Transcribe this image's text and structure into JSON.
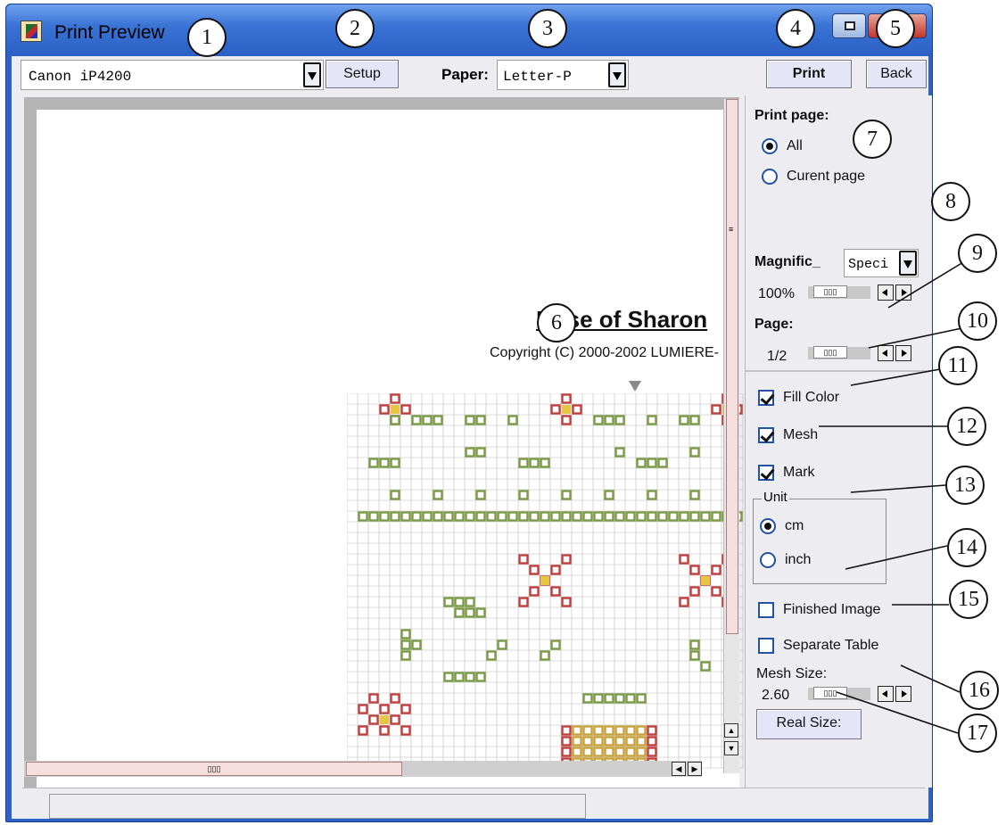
{
  "window": {
    "title": "Print Preview"
  },
  "toolbar": {
    "printer_value": "Canon iP4200",
    "setup_label": "Setup",
    "paper_label": "Paper:",
    "paper_value": "Letter-P",
    "print_label": "Print",
    "back_label": "Back"
  },
  "document": {
    "title": "Rose of Sharon",
    "copyright": "Copyright (C) 2000-2002 LUMIERE-"
  },
  "panel": {
    "print_page_label": "Print page:",
    "radio_all": "All",
    "radio_current": "Curent page",
    "magnification_label": "Magnific_",
    "magnification_value": "Speci",
    "zoom_value": "100%",
    "page_label": "Page:",
    "page_value": "1/2",
    "fill_color": "Fill Color",
    "mesh": "Mesh",
    "mark": "Mark",
    "unit_label": "Unit",
    "unit_cm": "cm",
    "unit_inch": "inch",
    "finished_image": "Finished Image",
    "separate_table": "Separate Table",
    "mesh_size_label": "Mesh Size:",
    "mesh_size_value": "2.60",
    "real_size": "Real Size:"
  },
  "state": {
    "print_page": "All",
    "fill_color": true,
    "mesh": true,
    "mark": true,
    "unit": "cm",
    "finished_image": false,
    "separate_table": false
  },
  "colors": {
    "title_bar": "#2f62c8",
    "button_face": "#e4e5f6",
    "stitch_red": "#c0403f",
    "stitch_green": "#7a9a45",
    "stitch_yellow": "#e6c642"
  },
  "callouts": [
    "1",
    "2",
    "3",
    "4",
    "5",
    "6",
    "7",
    "8",
    "9",
    "10",
    "11",
    "12",
    "13",
    "14",
    "15",
    "16",
    "17"
  ]
}
